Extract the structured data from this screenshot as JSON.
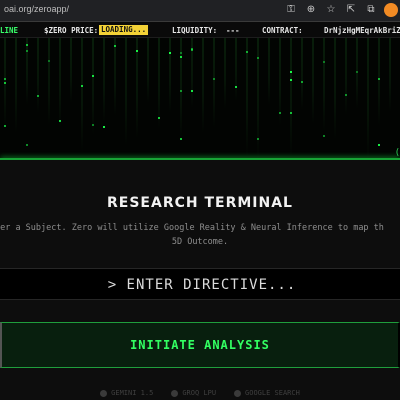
{
  "browser": {
    "url": "oai.org/zeroapp/",
    "icons": [
      "key-icon",
      "zoom-icon",
      "star-icon",
      "share-icon",
      "extension-icon",
      "profile-avatar"
    ]
  },
  "ticker": {
    "status": "LINE",
    "price_label": "$ZERO PRICE:",
    "price_value": "LOADING...",
    "liquidity_label": "LIQUIDITY:",
    "liquidity_value": "---",
    "contract_label": "CONTRACT:",
    "contract_value": "DrNjzHgMEqrAkBriZcqn"
  },
  "banner": {
    "bracket": "("
  },
  "terminal": {
    "title": "RESEARCH TERMINAL",
    "subtitle_line1": "er a Subject. Zero will utilize Google Reality & Neural Inference to map th",
    "subtitle_line2": "5D Outcome.",
    "directive_placeholder": "> ENTER DIRECTIVE...",
    "initiate_label": "INITIATE ANALYSIS"
  },
  "footer": {
    "items": [
      {
        "icon": "chip-icon",
        "label": "GEMINI 1.5"
      },
      {
        "icon": "bolt-icon",
        "label": "GROQ LPU"
      },
      {
        "icon": "globe-icon",
        "label": "GOOGLE SEARCH"
      }
    ]
  },
  "colors": {
    "accent_green": "#32ff62",
    "loading_yellow": "#f3d236",
    "background": "#0d0d0d"
  }
}
